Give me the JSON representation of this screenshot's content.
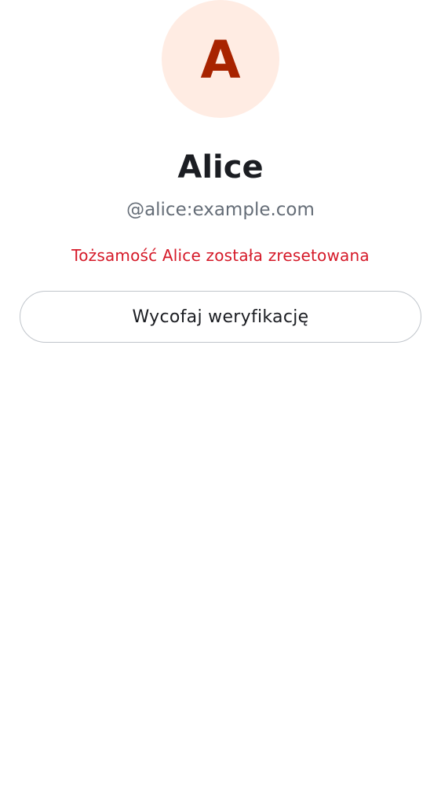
{
  "profile": {
    "avatar_initial": "A",
    "display_name": "Alice",
    "user_id": "@alice:example.com",
    "identity_warning": "Tożsamość Alice została zresetowana"
  },
  "actions": {
    "withdraw_verification_label": "Wycofaj weryfikację"
  },
  "colors": {
    "avatar_background": "#ffece3",
    "avatar_letter": "#a82300",
    "warning_text": "#d51928",
    "secondary_text": "#656d77",
    "primary_text": "#1b1d22",
    "button_border": "#c0c5cb"
  }
}
